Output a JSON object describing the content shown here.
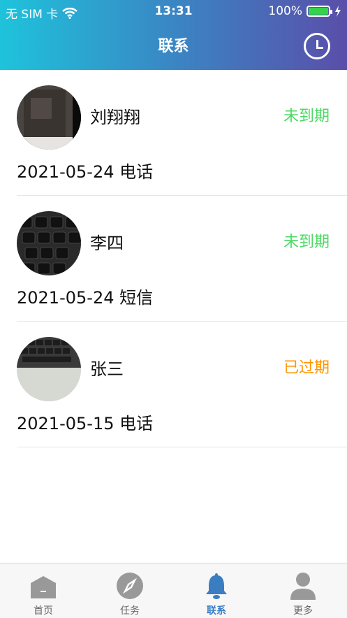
{
  "statusbar": {
    "carrier": "无 SIM 卡",
    "time": "13:31",
    "battery": "100%"
  },
  "header": {
    "title": "联系",
    "history_icon": "clock-icon"
  },
  "colors": {
    "green": "#4cd964",
    "orange": "#ff9500",
    "accent": "#3a7ec1"
  },
  "contacts": [
    {
      "name": "刘翔翔",
      "status": "未到期",
      "date": "2021-05-24",
      "type": "电话",
      "avatar": "dark-photo"
    },
    {
      "name": "李四",
      "status": "未到期",
      "date": "2021-05-24",
      "type": "短信",
      "avatar": "keyboard-photo"
    },
    {
      "name": "张三",
      "status": "已过期",
      "date": "2021-05-15",
      "type": "电话",
      "avatar": "laptop-photo"
    }
  ],
  "tabs": [
    {
      "label": "首页",
      "icon": "home-icon"
    },
    {
      "label": "任务",
      "icon": "compass-icon"
    },
    {
      "label": "联系",
      "icon": "bell-icon",
      "active": true
    },
    {
      "label": "更多",
      "icon": "person-icon"
    }
  ]
}
